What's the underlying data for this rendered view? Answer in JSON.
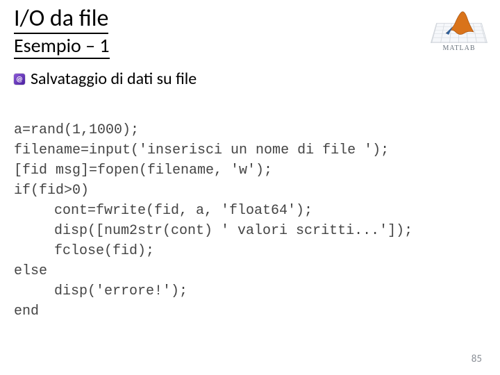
{
  "title": "I/O da file",
  "subtitle": "Esempio – 1",
  "bullet": "Salvataggio di dati su file",
  "bullet_icon_glyph": "@",
  "code": {
    "l1": "a=rand(1,1000);",
    "l2": "filename=input('inserisci un nome di file ');",
    "l3": "[fid msg]=fopen(filename, 'w');",
    "l4": "if(fid>0)",
    "l5": "cont=fwrite(fid, a, 'float64');",
    "l6": "disp([num2str(cont) ' valori scritti...']);",
    "l7": "fclose(fid);",
    "l8": "else",
    "l9": "disp('errore!');",
    "l10": "end"
  },
  "logo_text": "MATLAB",
  "page_number": "85"
}
